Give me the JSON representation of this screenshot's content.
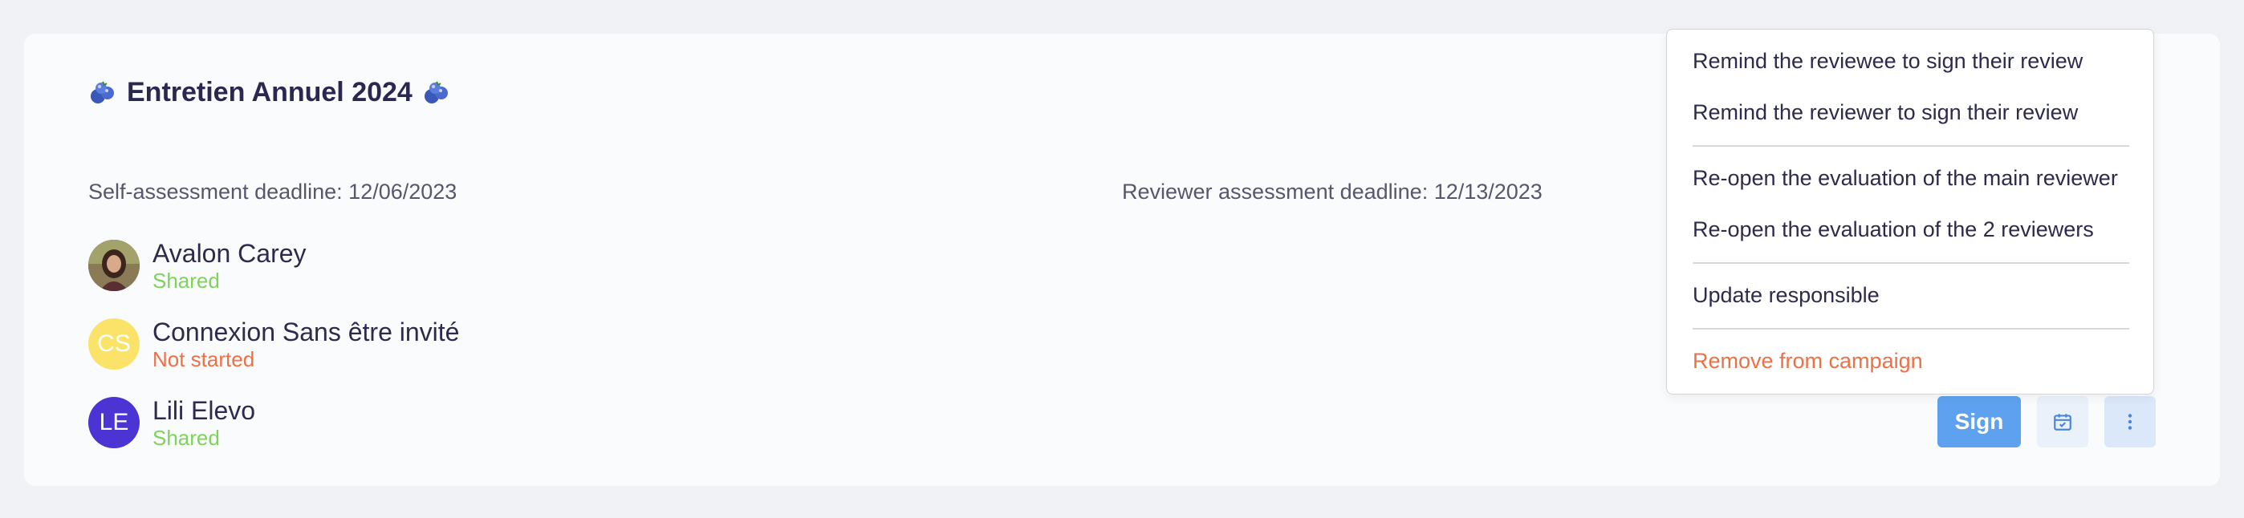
{
  "review": {
    "title": "Entretien Annuel 2024",
    "self_deadline": "Self-assessment deadline: 12/06/2023",
    "reviewer_deadline": "Reviewer assessment deadline: 12/13/2023"
  },
  "people": [
    {
      "name": "Avalon Carey",
      "initials": "",
      "status": "Shared",
      "avatar": "photo"
    },
    {
      "name": "Connexion Sans être invité",
      "initials": "CS",
      "status": "Not started",
      "avatar_color": "#fbe36a"
    },
    {
      "name": "Lili Elevo",
      "initials": "LE",
      "status": "Shared",
      "avatar_color": "#4c33d3"
    }
  ],
  "actions": {
    "sign_label": "Sign",
    "calendar_icon": "calendar-check-icon",
    "more_icon": "more-vertical-icon"
  },
  "menu": {
    "items": [
      "Remind the reviewee to sign their review",
      "Remind the reviewer to sign their review",
      "Re-open the evaluation of the main reviewer",
      "Re-open the evaluation of the 2 reviewers",
      "Update responsible",
      "Remove from campaign"
    ]
  },
  "colors": {
    "shared": "#7ed35a",
    "not_started": "#ee7045",
    "primary": "#5ea2ef",
    "danger": "#ee7045"
  }
}
